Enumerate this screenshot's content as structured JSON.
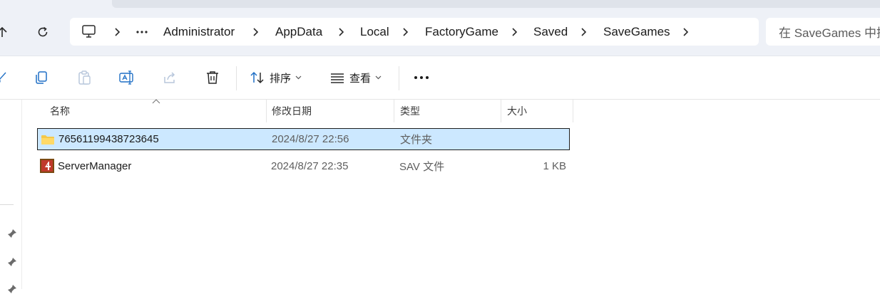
{
  "breadcrumb": {
    "items": [
      "Administrator",
      "AppData",
      "Local",
      "FactoryGame",
      "Saved",
      "SaveGames"
    ]
  },
  "search": {
    "placeholder": "在 SaveGames 中搜"
  },
  "toolbar": {
    "sort_label": "排序",
    "view_label": "查看"
  },
  "columns": {
    "name": "名称",
    "modified": "修改日期",
    "type": "类型",
    "size": "大小"
  },
  "files": [
    {
      "name": "76561199438723645",
      "modified": "2024/8/27 22:56",
      "type": "文件夹",
      "size": "",
      "icon": "folder-icon",
      "selected": true
    },
    {
      "name": "ServerManager",
      "modified": "2024/8/27 22:35",
      "type": "SAV 文件",
      "size": "1 KB",
      "icon": "sav-file-icon",
      "selected": false
    }
  ],
  "colors": {
    "selection": "#cce8ff",
    "folder": "#f4c84a",
    "accent": "#0a64c8"
  }
}
